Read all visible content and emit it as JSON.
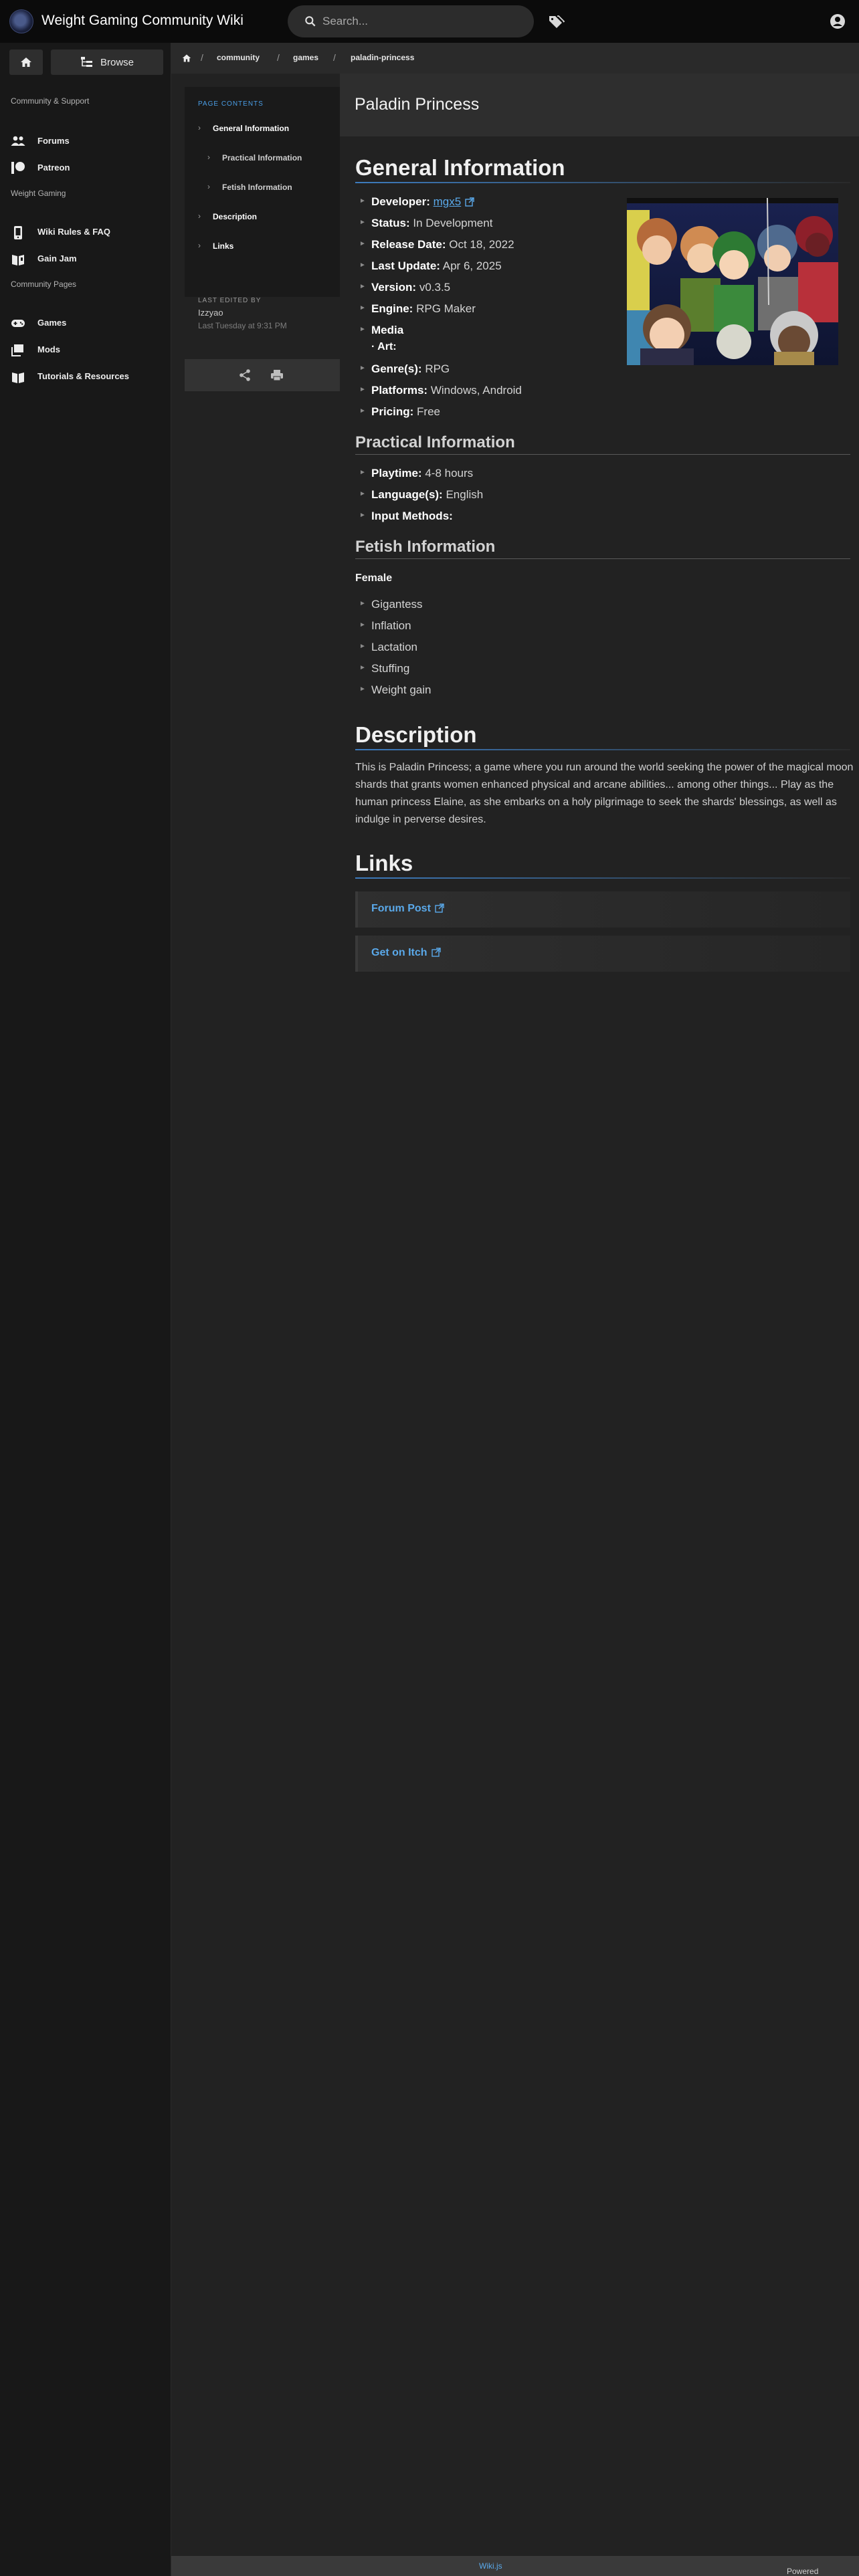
{
  "app": {
    "title": "Weight Gaming Community Wiki",
    "search_placeholder": "Search..."
  },
  "sidebar": {
    "browse_label": "Browse",
    "sections": [
      {
        "header": "Community & Support",
        "items": [
          {
            "label": "Forums",
            "icon": "people-icon"
          },
          {
            "label": "Patreon",
            "icon": "patreon-icon"
          }
        ]
      },
      {
        "header": "Weight Gaming",
        "items": [
          {
            "label": "Wiki Rules & FAQ",
            "icon": "phone-rules-icon"
          },
          {
            "label": "Gain Jam",
            "icon": "book-icon"
          }
        ]
      },
      {
        "header": "Community Pages",
        "items": [
          {
            "label": "Games",
            "icon": "gamepad-icon"
          },
          {
            "label": "Mods",
            "icon": "layers-icon"
          },
          {
            "label": "Tutorials & Resources",
            "icon": "book-open-icon"
          }
        ]
      }
    ]
  },
  "breadcrumb": [
    "community",
    "games",
    "paladin-princess"
  ],
  "toc": {
    "title": "PAGE CONTENTS",
    "items": [
      {
        "label": "General Information",
        "level": 1
      },
      {
        "label": "Practical Information",
        "level": 2
      },
      {
        "label": "Fetish Information",
        "level": 2
      },
      {
        "label": "Description",
        "level": 1
      },
      {
        "label": "Links",
        "level": 1
      }
    ],
    "last_edited_label": "LAST EDITED BY",
    "last_edited_user": "Izzyao",
    "last_edited_date": "Last Tuesday at 9:31 PM"
  },
  "page": {
    "title": "Paladin Princess",
    "general_heading": "General Information",
    "general": [
      {
        "key": "Developer:",
        "value": "mgx5",
        "link": true
      },
      {
        "key": "Status:",
        "value": "In Development"
      },
      {
        "key": "Release Date:",
        "value": "Oct 18, 2022"
      },
      {
        "key": "Last Update:",
        "value": "Apr 6, 2025"
      },
      {
        "key": "Version:",
        "value": "v0.3.5"
      },
      {
        "key": "Engine:",
        "value": "RPG Maker"
      },
      {
        "key": "Media",
        "value": ""
      },
      {
        "key": "Genre(s):",
        "value": "RPG"
      },
      {
        "key": "Platforms:",
        "value": "Windows, Android"
      },
      {
        "key": "Pricing:",
        "value": "Free"
      }
    ],
    "media_sub": "· Art:",
    "practical_heading": "Practical Information",
    "practical": [
      {
        "key": "Playtime:",
        "value": "4-8 hours"
      },
      {
        "key": "Language(s):",
        "value": "English"
      },
      {
        "key": "Input Methods:",
        "value": ""
      }
    ],
    "fetish_heading": "Fetish Information",
    "fetish_group": "Female",
    "fetish": [
      "Gigantess",
      "Inflation",
      "Lactation",
      "Stuffing",
      "Weight gain"
    ],
    "description_heading": "Description",
    "description": "This is Paladin Princess; a game where you run around the world seeking the power of the magical moon shards that grants women enhanced physical and arcane abilities... among other things... Play as the human princess Elaine, as she embarks on a holy pilgrimage to seek the shards' blessings, as well as indulge in perverse desires.",
    "links_heading": "Links",
    "links": [
      "Forum Post",
      "Get on Itch"
    ]
  },
  "footer": {
    "prefix": "Powered by",
    "link": "Wiki.js"
  },
  "colors": {
    "accent": "#5aa9ea",
    "heading_rule": "#3d7bbd",
    "background": "#222222"
  }
}
